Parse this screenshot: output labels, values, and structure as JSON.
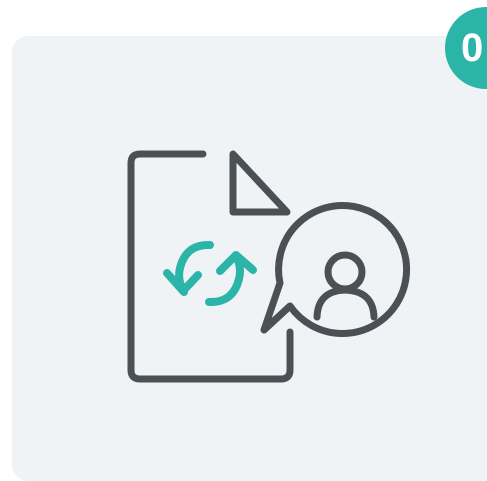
{
  "badge": {
    "label": "0",
    "color": "#2bb5a8"
  },
  "card": {
    "background": "#f0f3f5"
  },
  "illustration": {
    "icons": [
      "document-icon",
      "sync-arrows-icon",
      "user-speech-bubble-icon"
    ],
    "stroke_color": "#4b5055",
    "accent_color": "#2bb5a8"
  }
}
